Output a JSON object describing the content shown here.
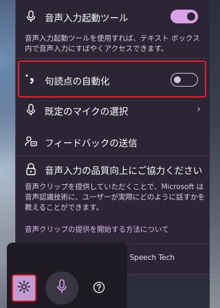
{
  "voice_typing_launcher": {
    "label": "音声入力起動ツール",
    "enabled": true,
    "description": "音声入力起動ツールを使用すれば、テキスト ボックス内で音声入力にすばやくアクセスできます。",
    "icon": "microphone-icon"
  },
  "auto_punctuation": {
    "label": "句読点の自動化",
    "enabled": false,
    "icon": "punctuation-icon"
  },
  "default_mic": {
    "label": "既定のマイクの選択",
    "icon": "microphone-icon"
  },
  "feedback": {
    "label": "フィードバックの送信",
    "icon": "feedback-icon"
  },
  "speech_quality": {
    "label": "音声入力の品質向上にご協力ください",
    "description": "音声クリップを提供していただくことで、Microsoft は音声認識技術に、ユーザーが実際にどのように話すかを教えることができます。",
    "link": "音声クリップの提供を開始する方法について",
    "icon": "lock-icon"
  },
  "footer": {
    "text": "Powered by Microsoft Online Speech Tech"
  },
  "taskbar": {
    "settings_icon": "gear-icon",
    "mic_icon": "microphone-icon",
    "help_icon": "help-icon"
  },
  "colors": {
    "accent": "#d9a2e8",
    "highlight": "#e0202a",
    "panel_bg": "#2b2535"
  }
}
